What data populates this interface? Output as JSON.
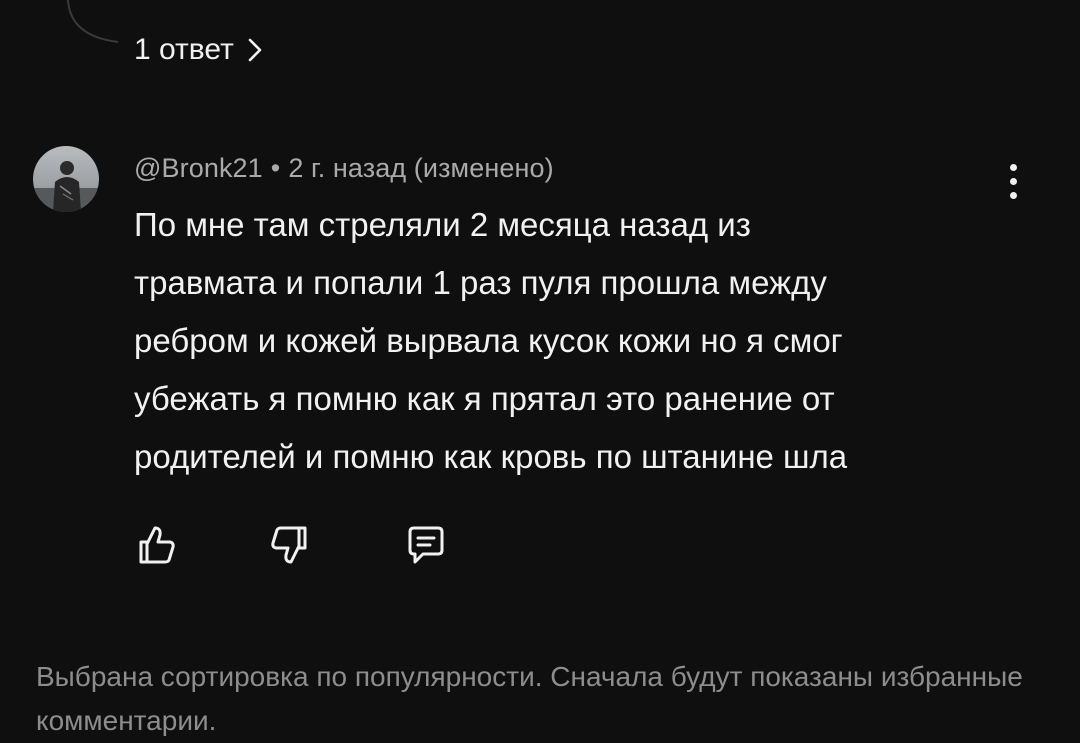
{
  "thread": {
    "replies_label": "1 ответ"
  },
  "comment": {
    "author": "@Bronk21",
    "separator": "•",
    "time": "2 г. назад (изменено)",
    "lines": [
      "По мне там стреляли 2 месяца назад из",
      "травмата и попали 1 раз пуля прошла между",
      "ребром и кожей вырвала кусок кожи но я смог",
      "убежать я помню как я прятал это ранение от",
      "родителей и помню как кровь по штанине шла"
    ],
    "actions": [
      "thumb-up-icon",
      "thumb-down-icon",
      "reply-icon"
    ]
  },
  "footer": {
    "sort_notice": "Выбрана сортировка по популярности. Сначала будут показаны избранные комментарии."
  },
  "colors": {
    "background": "#0f0f0f",
    "text": "#f1f1f1",
    "meta": "#aaaaaa",
    "notice": "#8d8d8d"
  }
}
